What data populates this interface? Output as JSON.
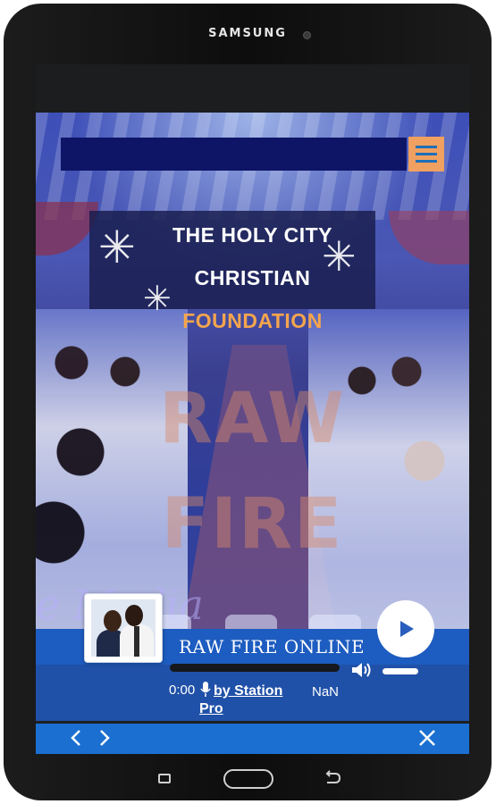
{
  "device": {
    "brand": "SAMSUNG"
  },
  "header": {
    "title_line1": "THE HOLY CITY",
    "title_line2": "CHRISTIAN",
    "title_line3": "FOUNDATION",
    "menu_icon": "hamburger-menu-icon"
  },
  "hero": {
    "watermark_line1": "RAW",
    "watermark_line2": "FIRE",
    "media_word": "e Media"
  },
  "player": {
    "station_name": "RAW FIRE ONLINE",
    "current_time": "0:00",
    "credit_line1": "by Station",
    "credit_line2": "Pro",
    "duration": "NaN",
    "play_icon": "play-icon",
    "volume_icon": "volume-icon",
    "mic_icon": "microphone-icon"
  },
  "bottom_nav": {
    "prev_icon": "chevron-left-icon",
    "next_icon": "chevron-right-icon",
    "close_icon": "close-icon"
  },
  "colors": {
    "topbar": "#0e1566",
    "menu_button": "#f0a060",
    "title_white": "#ffffff",
    "title_orange": "#f4a54e",
    "player_bg": "#2051a8",
    "navbar_bg": "#1a6fd1"
  }
}
